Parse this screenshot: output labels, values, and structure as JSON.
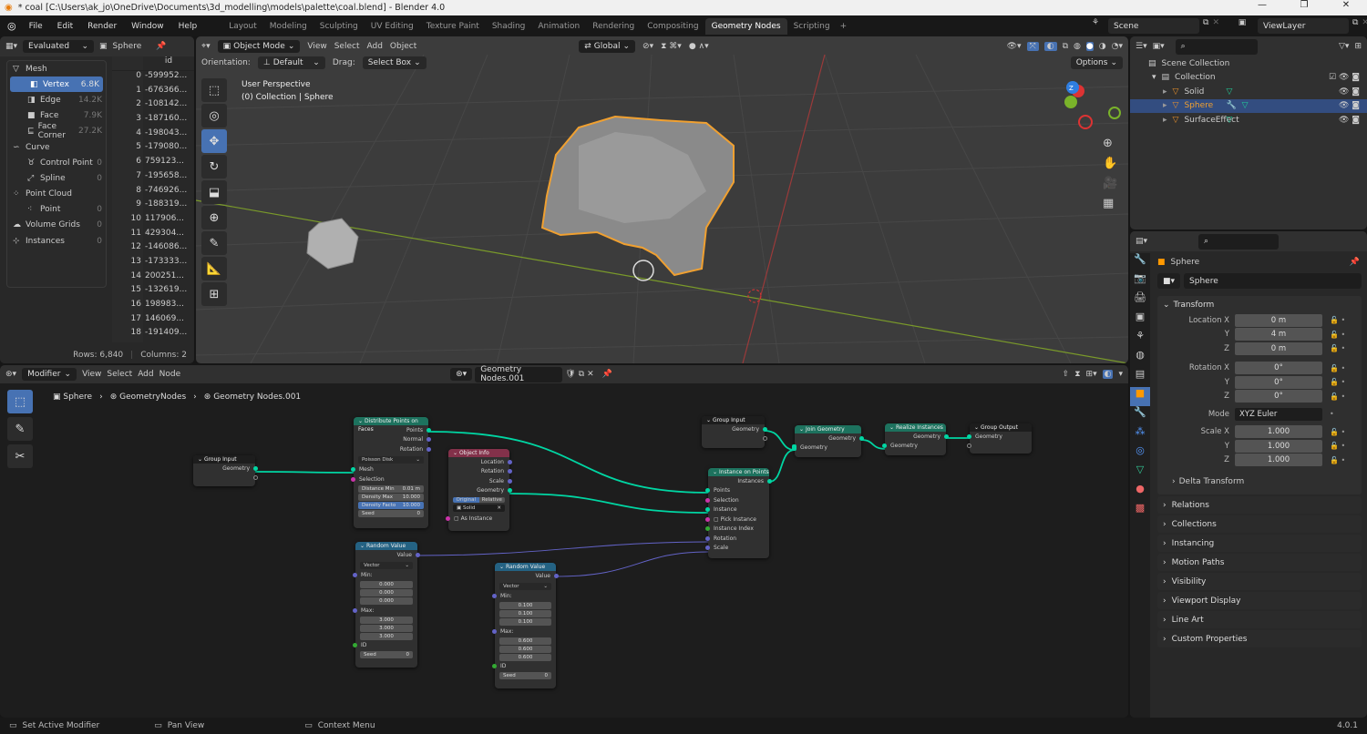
{
  "window": {
    "title": "* coal [C:\\Users\\ak_jo\\OneDrive\\Documents\\3d_modelling\\models\\palette\\coal.blend] - Blender 4.0",
    "minimize": "—",
    "maximize": "❐",
    "close": "✕"
  },
  "menu": [
    "File",
    "Edit",
    "Render",
    "Window",
    "Help"
  ],
  "workspaces": [
    "Layout",
    "Modeling",
    "Sculpting",
    "UV Editing",
    "Texture Paint",
    "Shading",
    "Animation",
    "Rendering",
    "Compositing",
    "Geometry Nodes",
    "Scripting"
  ],
  "active_workspace": "Geometry Nodes",
  "scene": "Scene",
  "view_layer": "ViewLayer",
  "spreadsheet": {
    "mode": "Evaluated",
    "object": "Sphere",
    "column": "id",
    "domains": [
      {
        "label": "Mesh",
        "count": "",
        "group": true
      },
      {
        "label": "Vertex",
        "count": "6.8K",
        "selected": true
      },
      {
        "label": "Edge",
        "count": "14.2K"
      },
      {
        "label": "Face",
        "count": "7.9K"
      },
      {
        "label": "Face Corner",
        "count": "27.2K"
      },
      {
        "label": "Curve",
        "count": "",
        "group": true
      },
      {
        "label": "Control Point",
        "count": "0"
      },
      {
        "label": "Spline",
        "count": "0"
      },
      {
        "label": "Point Cloud",
        "count": "",
        "group": true
      },
      {
        "label": "Point",
        "count": "0"
      },
      {
        "label": "Volume Grids",
        "count": "0",
        "group": true
      },
      {
        "label": "Instances",
        "count": "0",
        "group": true
      }
    ],
    "rows": [
      [
        "0",
        "-599952..."
      ],
      [
        "1",
        "-676366..."
      ],
      [
        "2",
        "-108142..."
      ],
      [
        "3",
        "-187160..."
      ],
      [
        "4",
        "-198043..."
      ],
      [
        "5",
        "-179080..."
      ],
      [
        "6",
        "759123..."
      ],
      [
        "7",
        "-195658..."
      ],
      [
        "8",
        "-746926..."
      ],
      [
        "9",
        "-188319..."
      ],
      [
        "10",
        "117906..."
      ],
      [
        "11",
        "429304..."
      ],
      [
        "12",
        "-146086..."
      ],
      [
        "13",
        "-173333..."
      ],
      [
        "14",
        "200251..."
      ],
      [
        "15",
        "-132619..."
      ],
      [
        "16",
        "198983..."
      ],
      [
        "17",
        "146069..."
      ],
      [
        "18",
        "-191409..."
      ]
    ],
    "footer_rows": "Rows: 6,840",
    "footer_cols": "Columns: 2"
  },
  "viewport": {
    "mode": "Object Mode",
    "menus": [
      "View",
      "Select",
      "Add",
      "Object"
    ],
    "orientation_label": "Orientation:",
    "orientation": "Default",
    "drag_label": "Drag:",
    "drag": "Select Box",
    "transform_orientation": "Global",
    "options": "Options",
    "overlay_line1": "User Perspective",
    "overlay_line2": "(0) Collection | Sphere",
    "gizmo": {
      "x": "X",
      "y": "Y",
      "z": "Z"
    }
  },
  "outliner": {
    "root": "Scene Collection",
    "collection": "Collection",
    "items": [
      {
        "name": "Solid",
        "selected": false
      },
      {
        "name": "Sphere",
        "selected": true
      },
      {
        "name": "SurfaceEffect",
        "selected": false
      }
    ]
  },
  "properties": {
    "object": "Sphere",
    "name_field": "Sphere",
    "transform_title": "Transform",
    "location": {
      "label": "Location X",
      "x": "0 m",
      "y": "4 m",
      "z": "0 m"
    },
    "rotation": {
      "label": "Rotation X",
      "x": "0°",
      "y": "0°",
      "z": "0°"
    },
    "mode_label": "Mode",
    "mode": "XYZ Euler",
    "scale": {
      "label": "Scale X",
      "x": "1.000",
      "y": "1.000",
      "z": "1.000"
    },
    "axis_y": "Y",
    "axis_z": "Z",
    "delta": "Delta Transform",
    "sections": [
      "Relations",
      "Collections",
      "Instancing",
      "Motion Paths",
      "Visibility",
      "Viewport Display",
      "Line Art",
      "Custom Properties"
    ]
  },
  "node_editor": {
    "editor_type": "Modifier",
    "menus": [
      "View",
      "Select",
      "Add",
      "Node"
    ],
    "tree": "Geometry Nodes.001",
    "breadcrumb": [
      "Sphere",
      "GeometryNodes",
      "Geometry Nodes.001"
    ],
    "nodes": {
      "group_input_1": {
        "title": "Group Input",
        "out": "Geometry"
      },
      "distribute": {
        "title": "Distribute Points on Faces",
        "outs": [
          "Points",
          "Normal",
          "Rotation"
        ],
        "method": "Poisson Disk",
        "mesh": "Mesh",
        "selection": "Selection",
        "distance_min": "Distance Min",
        "distance_min_v": "0.01 m",
        "density_max": "Density Max",
        "density_max_v": "10.000",
        "density_factor": "Density Facto",
        "density_factor_v": "10.000",
        "seed": "Seed",
        "seed_v": "0"
      },
      "object_info": {
        "title": "Object Info",
        "outs": [
          "Location",
          "Rotation",
          "Scale",
          "Geometry"
        ],
        "original": "Original",
        "relative": "Relative",
        "object": "Solid",
        "as_instance": "As Instance"
      },
      "random1": {
        "title": "Random Value",
        "out": "Value",
        "type": "Vector",
        "min": "Min:",
        "min_v": [
          "0.000",
          "0.000",
          "0.000"
        ],
        "max": "Max:",
        "max_v": [
          "3.000",
          "3.000",
          "3.000"
        ],
        "id": "ID",
        "seed": "Seed",
        "seed_v": "0"
      },
      "random2": {
        "title": "Random Value",
        "out": "Value",
        "type": "Vector",
        "min": "Min:",
        "min_v": [
          "0.100",
          "0.100",
          "0.100"
        ],
        "max": "Max:",
        "max_v": [
          "0.600",
          "0.600",
          "0.600"
        ],
        "id": "ID",
        "seed": "Seed",
        "seed_v": "0"
      },
      "group_input_2": {
        "title": "Group Input",
        "out": "Geometry"
      },
      "instance_on_points": {
        "title": "Instance on Points",
        "out": "Instances",
        "ins": [
          "Points",
          "Selection",
          "Instance",
          "Pick Instance",
          "Instance Index",
          "Rotation",
          "Scale"
        ]
      },
      "join": {
        "title": "Join Geometry",
        "out": "Geometry",
        "in": "Geometry"
      },
      "realize": {
        "title": "Realize Instances",
        "out": "Geometry",
        "in": "Geometry"
      },
      "group_output": {
        "title": "Group Output",
        "in": "Geometry"
      }
    }
  },
  "status": {
    "left": "Set Active Modifier",
    "mid": "Pan View",
    "right": "Context Menu",
    "version": "4.0.1"
  },
  "colors": {
    "accent": "#4772b3",
    "geometry_socket": "#00d6a3",
    "vector_socket": "#6363c7",
    "selection_orange": "#f0a030",
    "geo_header": "#1d725e",
    "input_header": "#83314a",
    "util_header": "#246283"
  }
}
